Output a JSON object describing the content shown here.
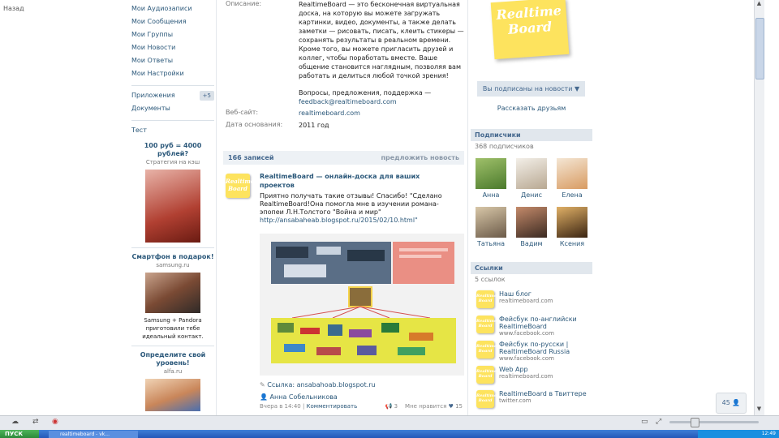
{
  "window": {
    "top_left_link": "Назад"
  },
  "left_nav": {
    "items": [
      "Мои Аудиозаписи",
      "Мои Сообщения",
      "Мои Группы",
      "Мои Новости",
      "Мои Ответы",
      "Мои Настройки"
    ],
    "apps_label": "Приложения",
    "apps_badge": "+5",
    "docs_label": "Документы",
    "extra_label": "Тест"
  },
  "ads": [
    {
      "title": "100 руб = 4000 рублей?",
      "sub": "Стратегия на кэш"
    },
    {
      "title": "Смартфон в подарок!",
      "sub": "samsung.ru"
    },
    {
      "caption": "Samsung + Pandora приготовили тебе идеальный контакт."
    },
    {
      "title": "Определите свой уровень!",
      "sub": "alfa.ru"
    }
  ],
  "info": {
    "description_label": "Описание:",
    "description": "RealtimeBoard — это бесконечная виртуальная доска, на которую вы можете загружать картинки, видео, документы, а также делать заметки — рисовать, писать, клеить стикеры — сохранять результаты в реальном времени. Кроме того, вы можете пригласить друзей и коллег, чтобы поработать вместе. Ваше общение становится наглядным, позволяя вам работать и делиться любой точкой зрения!",
    "feedback": "Вопросы, предложения, поддержка —",
    "feedback_email": "feedback@realtimeboard.com",
    "website_label": "Веб-сайт:",
    "website": "realtimeboard.com",
    "founded_label": "Дата основания:",
    "founded": "2011 год"
  },
  "wall": {
    "count": "166 записей",
    "suggest": "предложить новость",
    "post": {
      "title": "RealtimeBoard — онлайн-доска для ваших проектов",
      "text": "Приятно получать такие отзывы! Спасибо! \"Сделано RealtimeBoard!Она помогла мне в изучении романа-эпопеи Л.Н.Толстого \"Война и мир\"",
      "link_in_text": "http://ansabaheab.blogspot.ru/2015/02/10.html\"",
      "link": "Ссылка: ansabahoab.blogspot.ru",
      "author": "Анна Собельникова",
      "date": "Вчера в 14:40",
      "comment": "Комментировать",
      "reposts": "3",
      "likes_label": "Мне нравится",
      "likes": "15"
    }
  },
  "logo_text": "Realtime Board",
  "right": {
    "subscribe_button": "Вы подписаны на новости ▼",
    "tell_friends": "Рассказать друзьям",
    "subscribers_title": "Подписчики",
    "subscribers_count": "368 подписчиков",
    "members": [
      "Анна",
      "Денис",
      "Елена",
      "Татьяна",
      "Вадим",
      "Ксения"
    ],
    "links_title": "Ссылки",
    "links_count": "5 ссылок",
    "links": [
      {
        "name": "Наш блог",
        "url": "realtimeboard.com"
      },
      {
        "name": "Фейсбук по-английски RealtimeBoard",
        "url": "www.facebook.com"
      },
      {
        "name": "Фейсбук по-русски | RealtimeBoard Russia",
        "url": "www.facebook.com"
      },
      {
        "name": "Web App",
        "url": "realtimeboard.com"
      },
      {
        "name": "RealtimeBoard в Твиттере",
        "url": "twitter.com"
      }
    ]
  },
  "chat": {
    "label": "45 👤"
  },
  "taskbar": {
    "start": "ПУСК",
    "task": "realtimeboard - vk...",
    "clock": "12:49"
  }
}
